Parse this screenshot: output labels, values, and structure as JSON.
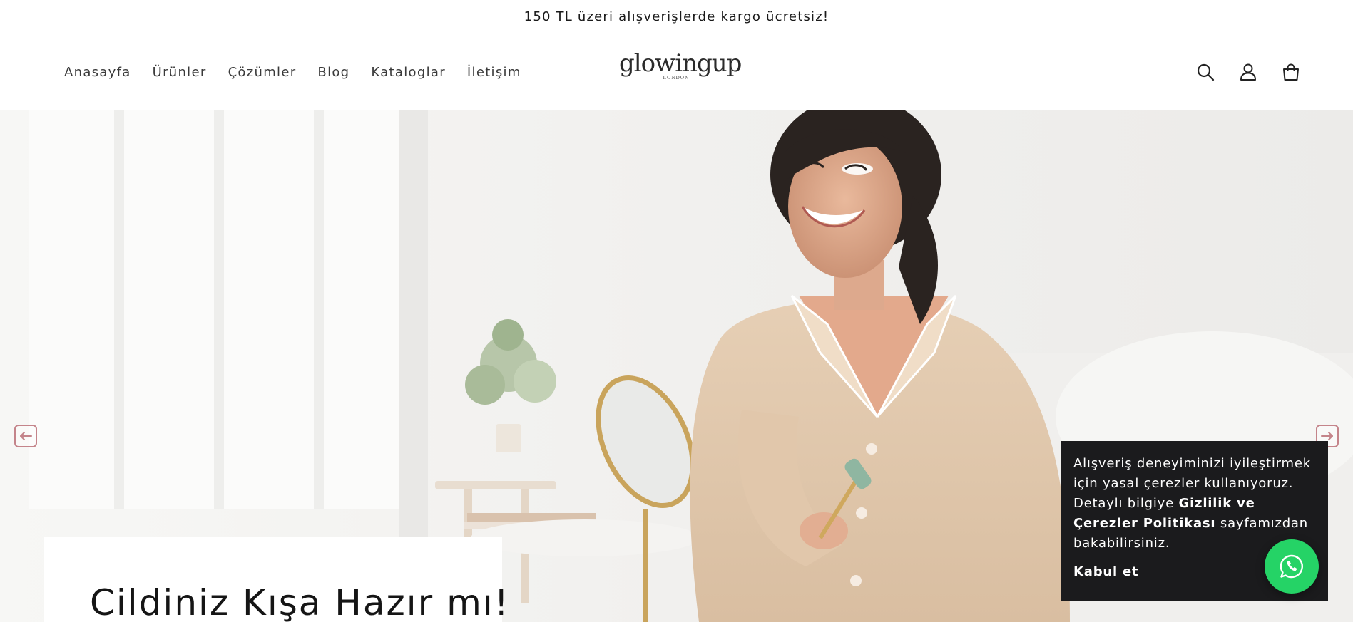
{
  "announcement": {
    "text": "150 TL üzeri alışverişlerde kargo ücretsiz!"
  },
  "header": {
    "nav": [
      {
        "label": "Anasayfa"
      },
      {
        "label": "Ürünler"
      },
      {
        "label": "Çözümler"
      },
      {
        "label": "Blog"
      },
      {
        "label": "Kataloglar"
      },
      {
        "label": "İletişim"
      }
    ],
    "logo": {
      "wordmark": "glowingup",
      "subtitle": "LONDON"
    },
    "icons": [
      "search-icon",
      "account-icon",
      "cart-icon"
    ]
  },
  "hero": {
    "title": "Cildiniz Kışa Hazır mı!",
    "prev_icon": "arrow-left-icon",
    "next_icon": "arrow-right-icon"
  },
  "cookie": {
    "text_part1": "Alışveriş deneyiminizi iyileştirmek için yasal çerezler kullanıyoruz. Detaylı bilgiye ",
    "link_text": "Gizlilik ve Çerezler Politikası",
    "text_part2": " sayfamızdan bakabilirsiniz.",
    "accept_label": "Kabul et"
  },
  "whatsapp": {
    "icon": "whatsapp-icon"
  },
  "colors": {
    "accent_arrow": "#c4848a",
    "whatsapp_green": "#25d366",
    "cookie_bg": "#1b1b1d"
  }
}
